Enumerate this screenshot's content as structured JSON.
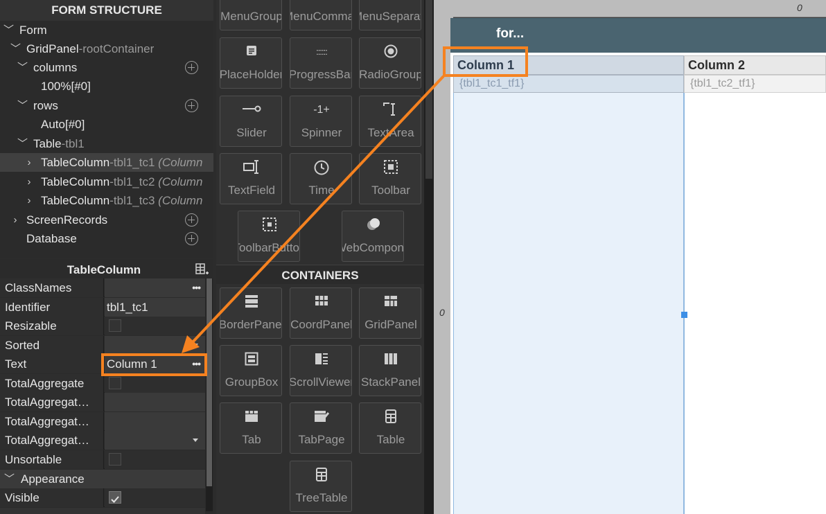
{
  "form_structure": {
    "title": "FORM STRUCTURE",
    "items": [
      {
        "label": "Form",
        "sub": "",
        "note": ""
      },
      {
        "label": "GridPanel",
        "sub": "-rootContainer",
        "note": ""
      },
      {
        "label": "columns",
        "sub": "",
        "note": ""
      },
      {
        "label": "100%[#0]",
        "sub": "",
        "note": ""
      },
      {
        "label": "rows",
        "sub": "",
        "note": ""
      },
      {
        "label": "Auto[#0]",
        "sub": "",
        "note": ""
      },
      {
        "label": "Table",
        "sub": "-tbl1",
        "note": ""
      },
      {
        "label": "TableColumn",
        "sub": "-tbl1_tc1",
        "note": "(Column"
      },
      {
        "label": "TableColumn",
        "sub": "-tbl1_tc2",
        "note": "(Column"
      },
      {
        "label": "TableColumn",
        "sub": "-tbl1_tc3",
        "note": "(Column"
      },
      {
        "label": "ScreenRecords",
        "sub": "",
        "note": ""
      },
      {
        "label": "Database",
        "sub": "",
        "note": ""
      }
    ]
  },
  "properties": {
    "title": "TableColumn",
    "rows": [
      {
        "key": "ClassNames",
        "value": ""
      },
      {
        "key": "Identifier",
        "value": "tbl1_tc1"
      },
      {
        "key": "Resizable",
        "value": ""
      },
      {
        "key": "Sorted",
        "value": ""
      },
      {
        "key": "Text",
        "value": "Column 1"
      },
      {
        "key": "TotalAggregate",
        "value": ""
      },
      {
        "key": "TotalAggregat…",
        "value": ""
      },
      {
        "key": "TotalAggregat…",
        "value": ""
      },
      {
        "key": "TotalAggregat…",
        "value": ""
      },
      {
        "key": "Unsortable",
        "value": ""
      }
    ],
    "appearance_label": "Appearance",
    "visible_key": "Visible"
  },
  "palette": {
    "tiles_top": [
      "MenuGroup",
      "MenuCommand",
      "MenuSeparator"
    ],
    "tiles": [
      "PlaceHolder",
      "ProgressBar",
      "RadioGroup",
      "Slider",
      "Spinner",
      "TextArea",
      "TextField",
      "Time",
      "Toolbar",
      "ToolbarButton",
      "WebComponent"
    ],
    "containers_title": "CONTAINERS",
    "containers": [
      "BorderPanel",
      "CoordPanel",
      "GridPanel",
      "GroupBox",
      "ScrollViewer",
      "StackPanel",
      "Tab",
      "TabPage",
      "Table",
      "TreeTable"
    ],
    "icons": {
      "PlaceHolder": "placeholder-icon",
      "ProgressBar": "progress-dots-icon",
      "RadioGroup": "radio-icon",
      "Slider": "slider-icon",
      "Spinner": "spinner-icon",
      "TextArea": "textarea-icon",
      "TextField": "textfield-icon",
      "Time": "clock-icon",
      "Toolbar": "toolbar-icon",
      "ToolbarButton": "toolbar-button-icon",
      "WebComponent": "web-component-icon"
    }
  },
  "canvas": {
    "ruler_top_zero": "0",
    "ruler_left_zero": "0",
    "form_title": "for...",
    "columns": [
      {
        "header": "Column 1",
        "cell": "{tbl1_tc1_tf1}"
      },
      {
        "header": "Column 2",
        "cell": "{tbl1_tc2_tf1}"
      }
    ]
  },
  "colors": {
    "accent": "#f58220",
    "header_bar": "#4a6470",
    "selection_blue": "#3d8fe6"
  }
}
